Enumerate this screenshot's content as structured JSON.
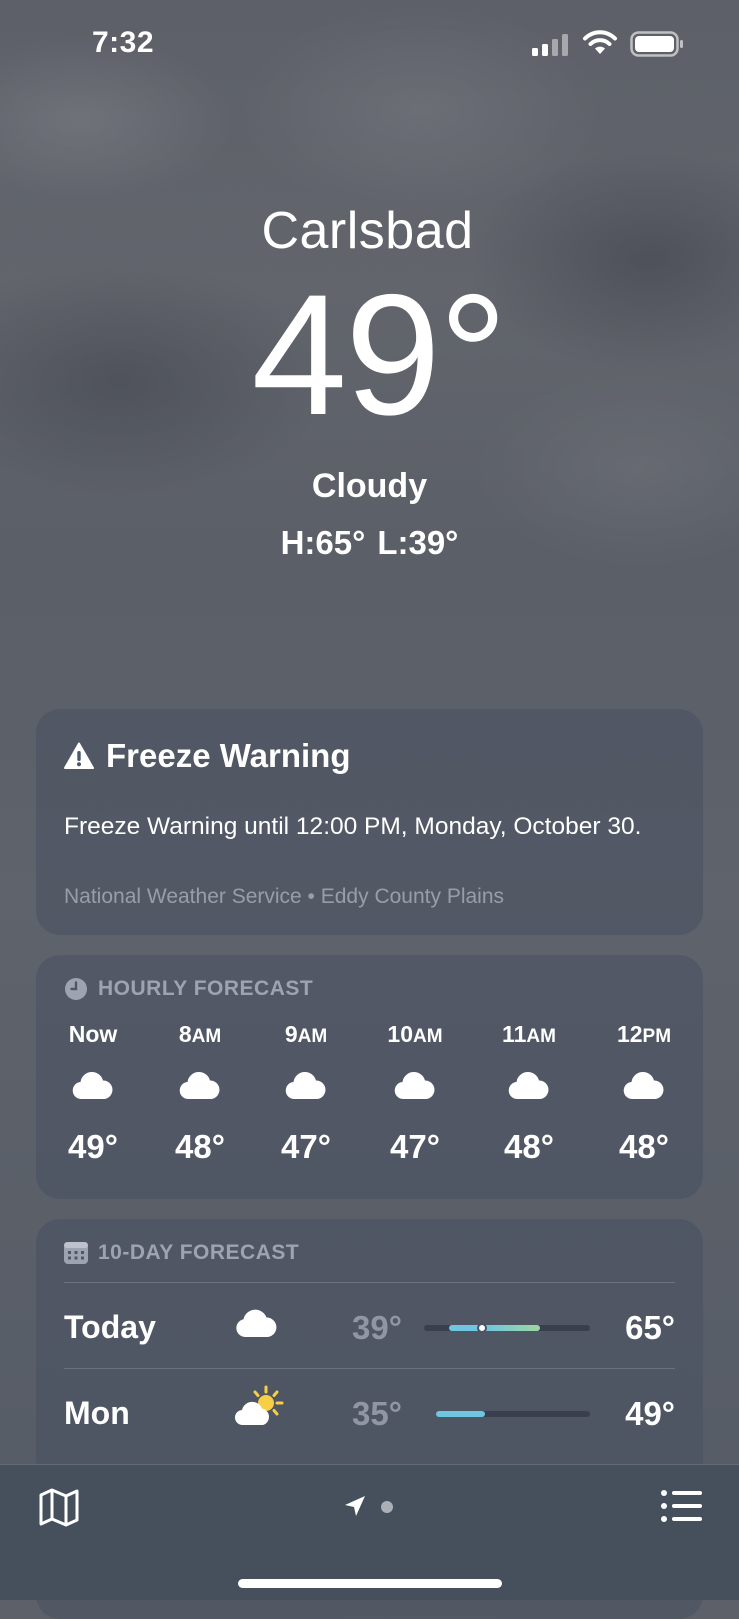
{
  "status_bar": {
    "time": "7:32"
  },
  "location": {
    "city": "Carlsbad",
    "temperature": "49°",
    "condition": "Cloudy",
    "high": "H:65°",
    "low": "L:39°"
  },
  "alert": {
    "title": "Freeze Warning",
    "text": "Freeze Warning until 12:00 PM, Monday, October 30.",
    "source": "National Weather Service • Eddy County Plains",
    "icon": "warning-triangle-icon"
  },
  "hourly": {
    "heading": "HOURLY FORECAST",
    "icon": "clock-icon",
    "items": [
      {
        "label": "Now",
        "temp": "49°",
        "icon": "cloud-icon"
      },
      {
        "label": "8AM",
        "temp": "48°",
        "icon": "cloud-icon"
      },
      {
        "label": "9AM",
        "temp": "47°",
        "icon": "cloud-icon"
      },
      {
        "label": "10AM",
        "temp": "47°",
        "icon": "cloud-icon"
      },
      {
        "label": "11AM",
        "temp": "48°",
        "icon": "cloud-icon"
      },
      {
        "label": "12PM",
        "temp": "48°",
        "icon": "cloud-icon"
      }
    ]
  },
  "daily": {
    "heading": "10-DAY FORECAST",
    "icon": "calendar-icon",
    "items": [
      {
        "day": "Today",
        "low": "39°",
        "high": "65°",
        "icon": "cloud-icon",
        "range_start": 0.15,
        "range_end": 0.7,
        "current": 0.35
      },
      {
        "day": "Mon",
        "low": "35°",
        "high": "49°",
        "icon": "partly-sunny-icon",
        "range_start": 0.0,
        "range_end": 0.32
      }
    ]
  },
  "tab_bar": {
    "map_icon": "map-icon",
    "location_icon": "location-arrow-icon",
    "list_icon": "list-icon"
  },
  "colors": {
    "card_bg": "#4a5363",
    "range_cool": "#6ec6e0",
    "range_warm": "#9ed6a0",
    "tab_bg": "#46505d"
  }
}
